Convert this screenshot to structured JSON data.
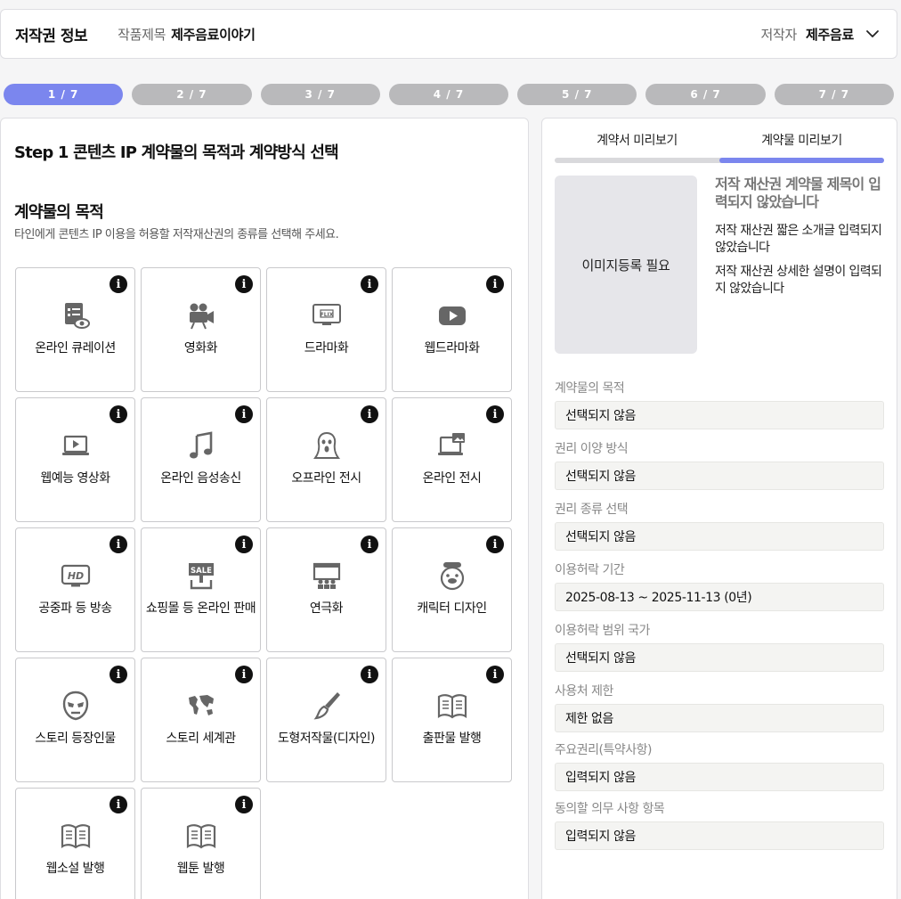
{
  "header": {
    "title": "저작권 정보",
    "work_label": "작품제목",
    "work_value": "제주음료이야기",
    "author_label": "저작자",
    "author_value": "제주음료"
  },
  "steps": [
    "1 / 7",
    "2 / 7",
    "3 / 7",
    "4 / 7",
    "5 / 7",
    "6 / 7",
    "7 / 7"
  ],
  "active_step": 1,
  "colors": {
    "accent": "#7b86ee",
    "inactive_step": "#b9b9bb"
  },
  "left": {
    "step_title": "Step 1 콘텐츠 IP 계약물의 목적과 계약방식 선택",
    "section_title": "계약물의 목적",
    "section_desc": "타인에게 콘텐츠 IP 이용을 허용할 저작재산권의 종류를 선택해 주세요.",
    "info_symbol": "i",
    "purposes": [
      {
        "label": "온라인 큐레이션",
        "icon": "online-curation-icon"
      },
      {
        "label": "영화화",
        "icon": "movie-camera-icon"
      },
      {
        "label": "드라마화",
        "icon": "tv-flix-icon"
      },
      {
        "label": "웹드라마화",
        "icon": "play-button-icon"
      },
      {
        "label": "웹예능 영상화",
        "icon": "laptop-play-icon"
      },
      {
        "label": "온라인 음성송신",
        "icon": "music-note-icon"
      },
      {
        "label": "오프라인 전시",
        "icon": "painting-scream-icon"
      },
      {
        "label": "온라인 전시",
        "icon": "laptop-image-icon"
      },
      {
        "label": "공중파 등 방송",
        "icon": "hd-tv-icon"
      },
      {
        "label": "쇼핑몰 등 온라인 판매",
        "icon": "sale-sign-icon"
      },
      {
        "label": "연극화",
        "icon": "theater-stage-icon"
      },
      {
        "label": "캐릭터 디자인",
        "icon": "character-face-icon"
      },
      {
        "label": "스토리 등장인물",
        "icon": "mask-icon"
      },
      {
        "label": "스토리 세계관",
        "icon": "world-map-icon"
      },
      {
        "label": "도형저작물(디자인)",
        "icon": "paint-brush-icon"
      },
      {
        "label": "출판물 발행",
        "icon": "open-book-icon"
      },
      {
        "label": "웹소설 발행",
        "icon": "open-book-icon"
      },
      {
        "label": "웹툰 발행",
        "icon": "open-book-icon"
      }
    ]
  },
  "right": {
    "tabs": [
      "계약서 미리보기",
      "계약물 미리보기"
    ],
    "active_tab": 1,
    "image_placeholder": "이미지등록 필요",
    "preview_title": "저작 재산권 계약물 제목이 입력되지 않았습니다",
    "preview_short": "저작 재산권 짧은 소개글 입력되지 않았습니다",
    "preview_long": "저작 재산권 상세한 설명이 입력되지 않았습니다",
    "fields": [
      {
        "label": "계약물의 목적",
        "value": "선택되지 않음"
      },
      {
        "label": "권리 이양 방식",
        "value": "선택되지 않음"
      },
      {
        "label": "권리 종류 선택",
        "value": "선택되지 않음"
      },
      {
        "label": "이용허락 기간",
        "value": "2025-08-13 ~ 2025-11-13 (0년)"
      },
      {
        "label": "이용허락 범위 국가",
        "value": "선택되지 않음"
      },
      {
        "label": "사용처 제한",
        "value": "제한 없음"
      },
      {
        "label": "주요권리(특약사항)",
        "value": "입력되지 않음"
      },
      {
        "label": "동의할 의무 사항 항목",
        "value": "입력되지 않음"
      }
    ]
  }
}
